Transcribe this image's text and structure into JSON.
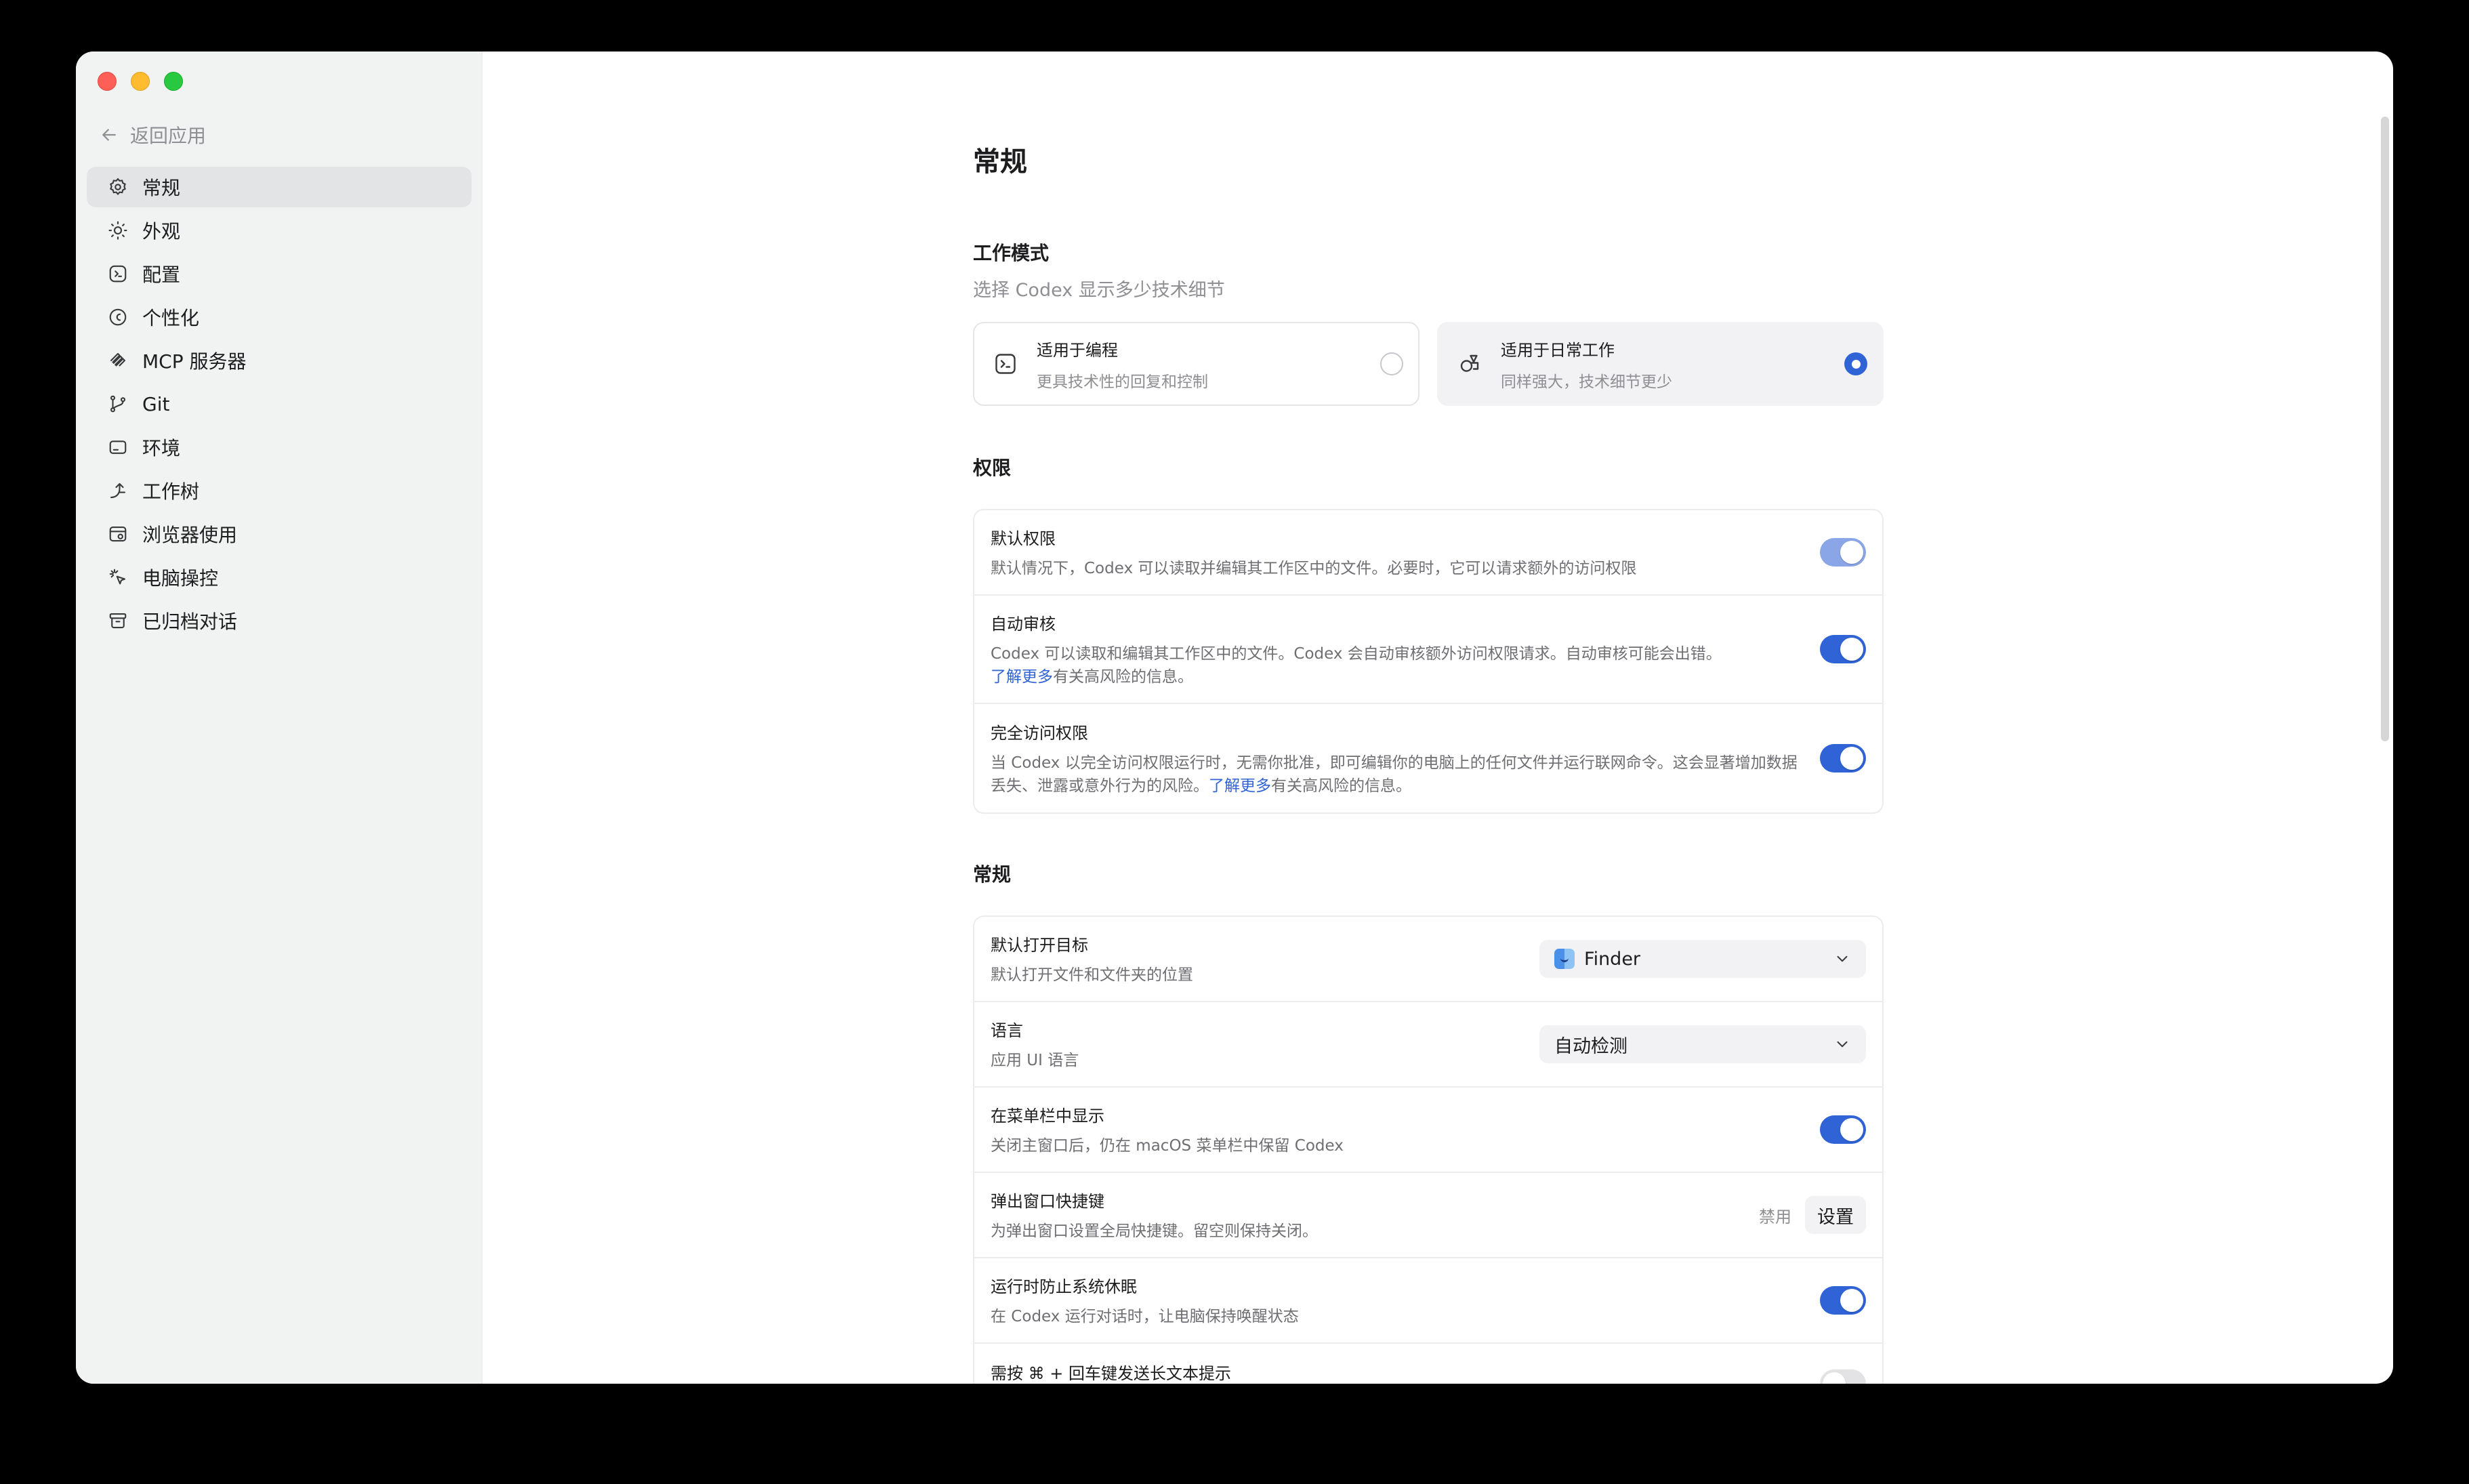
{
  "sidebar": {
    "back_label": "返回应用",
    "items": [
      {
        "label": "常规",
        "icon": "gear-icon",
        "active": true
      },
      {
        "label": "外观",
        "icon": "sun-icon"
      },
      {
        "label": "配置",
        "icon": "config-icon"
      },
      {
        "label": "个性化",
        "icon": "personalize-icon"
      },
      {
        "label": "MCP 服务器",
        "icon": "mcp-icon"
      },
      {
        "label": "Git",
        "icon": "git-branch-icon"
      },
      {
        "label": "环境",
        "icon": "environment-icon"
      },
      {
        "label": "工作树",
        "icon": "worktree-icon"
      },
      {
        "label": "浏览器使用",
        "icon": "browser-icon"
      },
      {
        "label": "电脑操控",
        "icon": "computer-control-icon"
      },
      {
        "label": "已归档对话",
        "icon": "archive-icon"
      }
    ]
  },
  "main": {
    "title": "常规",
    "work_mode": {
      "title": "工作模式",
      "subtitle": "选择 Codex 显示多少技术细节",
      "options": [
        {
          "title": "适用于编程",
          "desc": "更具技术性的回复和控制",
          "selected": false
        },
        {
          "title": "适用于日常工作",
          "desc": "同样强大，技术细节更少",
          "selected": true
        }
      ]
    },
    "permissions": {
      "title": "权限",
      "default": {
        "title": "默认权限",
        "desc": "默认情况下，Codex 可以读取并编辑其工作区中的文件。必要时，它可以请求额外的访问权限"
      },
      "auto_review": {
        "title": "自动审核",
        "desc": "Codex 可以读取和编辑其工作区中的文件。Codex 会自动审核额外访问权限请求。自动审核可能会出错。",
        "link": "了解更多",
        "link_suffix": "有关高风险的信息。"
      },
      "full_access": {
        "title": "完全访问权限",
        "desc": "当 Codex 以完全访问权限运行时，无需你批准，即可编辑你的电脑上的任何文件并运行联网命令。这会显著增加数据丢失、泄露或意外行为的风险。",
        "link": "了解更多",
        "link_suffix": "有关高风险的信息。"
      }
    },
    "general": {
      "title": "常规",
      "open_target": {
        "title": "默认打开目标",
        "desc": "默认打开文件和文件夹的位置",
        "value": "Finder"
      },
      "language": {
        "title": "语言",
        "desc": "应用 UI 语言",
        "value": "自动检测"
      },
      "menubar": {
        "title": "在菜单栏中显示",
        "desc": "关闭主窗口后，仍在 macOS 菜单栏中保留 Codex"
      },
      "popup_shortcut": {
        "title": "弹出窗口快捷键",
        "desc": "为弹出窗口设置全局快捷键。留空则保持关闭。",
        "status": "禁用",
        "button": "设置"
      },
      "prevent_sleep": {
        "title": "运行时防止系统休眠",
        "desc": "在 Codex 运行对话时，让电脑保持唤醒状态"
      },
      "cmd_enter": {
        "title": "需按 ⌘ + 回车键发送长文本提示"
      }
    }
  },
  "colors": {
    "accent": "#2f63d6",
    "sidebar_bg": "#f1f2f2"
  }
}
